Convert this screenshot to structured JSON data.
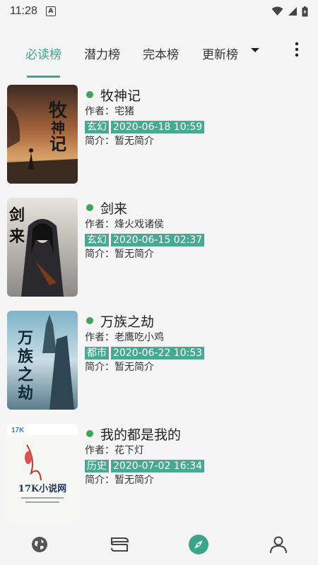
{
  "status": {
    "time": "11:28",
    "notification_letter": "A"
  },
  "tabs": [
    {
      "label": "必读榜",
      "active": true
    },
    {
      "label": "潜力榜",
      "active": false
    },
    {
      "label": "完本榜",
      "active": false
    },
    {
      "label": "更新榜",
      "active": false
    }
  ],
  "labels": {
    "author": "作者：",
    "intro": "简介："
  },
  "books": [
    {
      "title": "牧神记",
      "author": "宅猪",
      "genre": "玄幻",
      "updated": "2020-06-18 10:59",
      "intro": "暂无简介",
      "cover_text": "牧神记"
    },
    {
      "title": "剑来",
      "author": "烽火戏诸侯",
      "genre": "玄幻",
      "updated": "2020-06-15 02:37",
      "intro": "暂无简介",
      "cover_text": "剑来"
    },
    {
      "title": "万族之劫",
      "author": "老鹰吃小鸡",
      "genre": "都市",
      "updated": "2020-06-22 10:53",
      "intro": "暂无简介",
      "cover_text": "万族之劫"
    },
    {
      "title": "我的都是我的",
      "author": "花下灯",
      "genre": "历史",
      "updated": "2020-07-02 16:34",
      "intro": "暂无简介",
      "cover_text": "17K小说网"
    }
  ],
  "bottom_nav": [
    {
      "name": "globe-icon",
      "active": false
    },
    {
      "name": "bookshelf-icon",
      "active": false
    },
    {
      "name": "compass-icon",
      "active": true
    },
    {
      "name": "user-icon",
      "active": false
    }
  ],
  "colors": {
    "accent": "#3aa58c",
    "tag_bg": "#48a892",
    "dot": "#43a35a"
  }
}
